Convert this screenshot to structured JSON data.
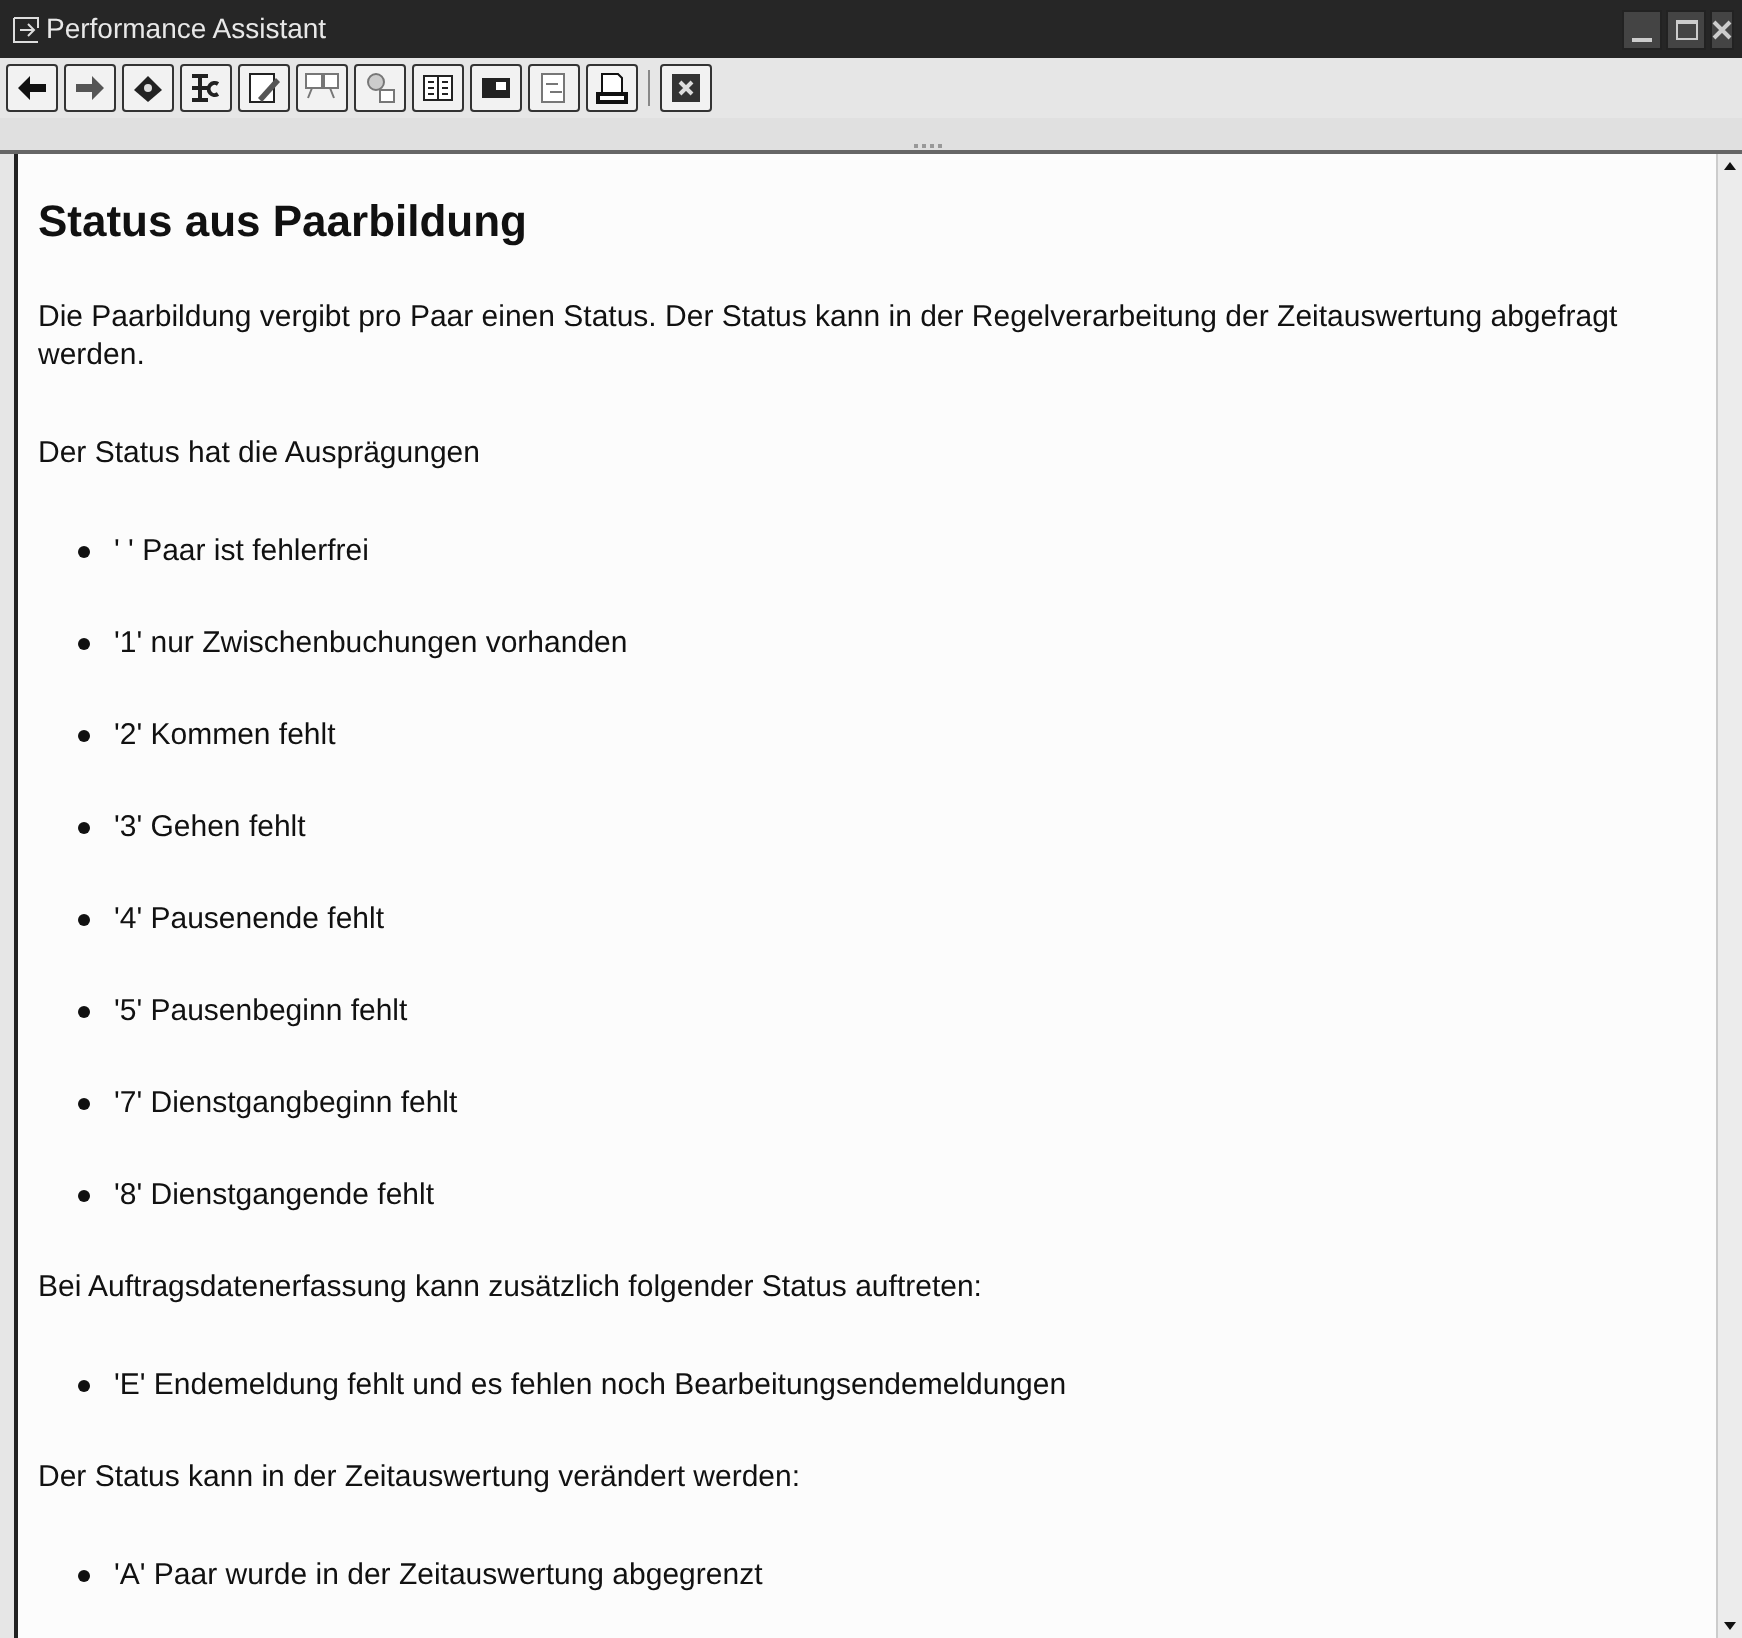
{
  "window": {
    "title": "Performance Assistant"
  },
  "content": [
    {
      "kind": "heading",
      "text": "Status aus Paarbildung"
    },
    {
      "kind": "paragraph",
      "text": "Die Paarbildung vergibt pro Paar einen Status. Der Status kann in der Regelverarbeitung der Zeitauswertung abgefragt werden."
    },
    {
      "kind": "paragraph",
      "text": "Der Status hat die Ausprägungen"
    },
    {
      "kind": "bullet",
      "text": "' ' Paar ist fehlerfrei"
    },
    {
      "kind": "bullet",
      "text": "'1' nur Zwischenbuchungen vorhanden"
    },
    {
      "kind": "bullet",
      "text": "'2' Kommen fehlt"
    },
    {
      "kind": "bullet",
      "text": "'3' Gehen fehlt"
    },
    {
      "kind": "bullet",
      "text": "'4' Pausenende fehlt"
    },
    {
      "kind": "bullet",
      "text": "'5' Pausenbeginn fehlt"
    },
    {
      "kind": "bullet",
      "text": "'7' Dienstgangbeginn fehlt"
    },
    {
      "kind": "bullet",
      "text": "'8' Dienstgangende fehlt"
    },
    {
      "kind": "paragraph",
      "text": "Bei Auftragsdatenerfassung kann zusätzlich folgender Status auftreten:"
    },
    {
      "kind": "bullet",
      "text": "'E' Endemeldung fehlt und es fehlen noch Bearbeitungsendemeldungen"
    },
    {
      "kind": "paragraph",
      "text": "Der Status kann in der Zeitauswertung verändert werden:"
    },
    {
      "kind": "bullet",
      "text": "'A' Paar wurde in der Zeitauswertung abgegrenzt"
    }
  ]
}
